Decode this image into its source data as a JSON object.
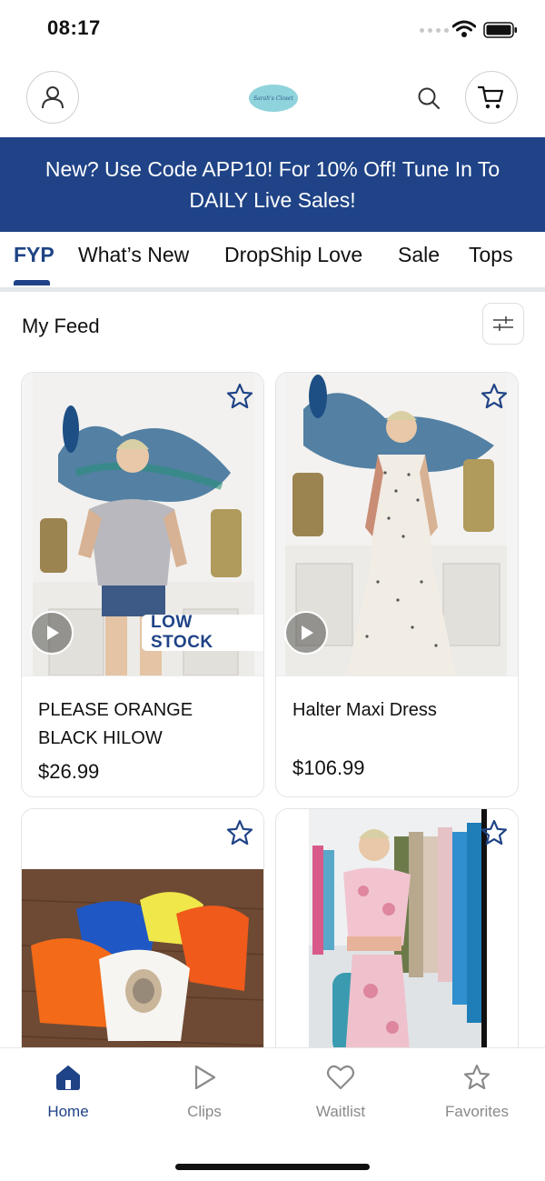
{
  "status_bar": {
    "time": "08:17"
  },
  "header": {
    "icons": [
      "user-icon",
      "store-logo",
      "search-icon",
      "cart-icon"
    ],
    "logo_text": "Sarah's Closet"
  },
  "promo": {
    "text": "New? Use Code APP10! For 10% Off! Tune In To DAILY Live Sales!"
  },
  "tabs": [
    {
      "label": "FYP",
      "active": true
    },
    {
      "label": "What’s New",
      "active": false
    },
    {
      "label": "DropShip Love",
      "active": false
    },
    {
      "label": "Sale",
      "active": false
    },
    {
      "label": "Tops",
      "active": false
    }
  ],
  "feed": {
    "title": "My Feed",
    "products": [
      {
        "name": "PLEASE ORANGE BLACK HILOW",
        "price": "$26.99",
        "badge": "LOW STOCK",
        "has_video": true,
        "favorited": false
      },
      {
        "name": "Halter Maxi Dress",
        "price": "$106.99",
        "badge": "",
        "has_video": true,
        "favorited": false
      },
      {
        "name": "",
        "price": "",
        "badge": "",
        "has_video": false,
        "favorited": false
      },
      {
        "name": "",
        "price": "",
        "badge": "",
        "has_video": false,
        "favorited": false
      }
    ]
  },
  "bottom_nav": [
    {
      "label": "Home",
      "icon": "home-icon",
      "active": true
    },
    {
      "label": "Clips",
      "icon": "play-icon",
      "active": false
    },
    {
      "label": "Waitlist",
      "icon": "heart-icon",
      "active": false
    },
    {
      "label": "Favorites",
      "icon": "star-icon",
      "active": false
    }
  ],
  "colors": {
    "brand": "#1f4386",
    "inactive": "#8a8a8a",
    "divider": "#e3e6ea"
  }
}
